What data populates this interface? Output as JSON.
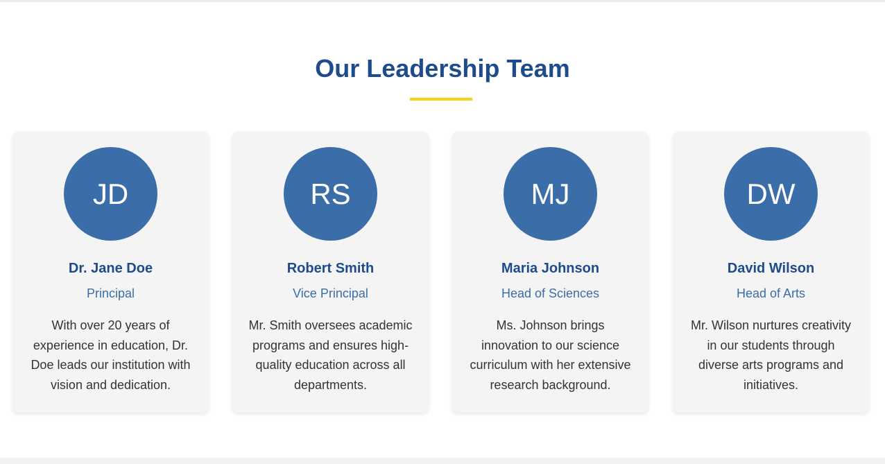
{
  "section": {
    "title": "Our Leadership Team"
  },
  "colors": {
    "heading": "#1d4b8c",
    "accent_underline": "#f6d40f",
    "avatar_bg": "#3b6ea8",
    "card_bg": "#f4f4f4",
    "body_text": "#333333"
  },
  "team": [
    {
      "initials": "JD",
      "name": "Dr. Jane Doe",
      "role": "Principal",
      "bio": "With over 20 years of experience in education, Dr. Doe leads our institution with vision and dedication."
    },
    {
      "initials": "RS",
      "name": "Robert Smith",
      "role": "Vice Principal",
      "bio": "Mr. Smith oversees academic programs and ensures high-quality education across all departments."
    },
    {
      "initials": "MJ",
      "name": "Maria Johnson",
      "role": "Head of Sciences",
      "bio": "Ms. Johnson brings innovation to our science curriculum with her extensive research background."
    },
    {
      "initials": "DW",
      "name": "David Wilson",
      "role": "Head of Arts",
      "bio": "Mr. Wilson nurtures creativity in our students through diverse arts programs and initiatives."
    }
  ]
}
